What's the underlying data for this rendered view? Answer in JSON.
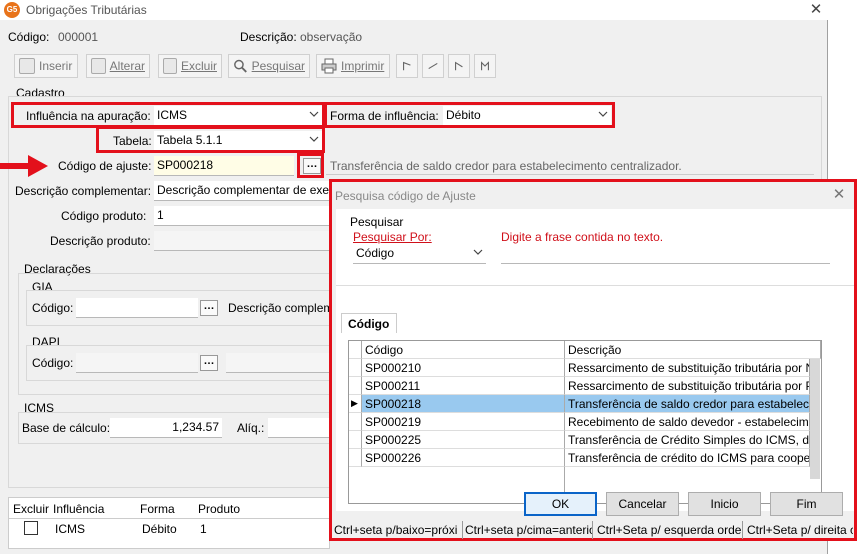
{
  "window": {
    "title": "Obrigações Tributárias",
    "app_icon_text": "G5"
  },
  "header": {
    "codigo_label": "Código:",
    "codigo_value": "000001",
    "descricao_label": "Descrição:",
    "descricao_value": "observação"
  },
  "toolbar": {
    "inserir": "Inserir",
    "alterar": "Alterar",
    "excluir": "Excluir",
    "pesquisar": "Pesquisar",
    "imprimir": "Imprimir"
  },
  "cadastro": {
    "section_label": "Cadastro",
    "influencia_label": "Influência na apuração:",
    "influencia_value": "ICMS",
    "forma_label": "Forma de influência:",
    "forma_value": "Débito",
    "tabela_label": "Tabela:",
    "tabela_value": "Tabela 5.1.1",
    "codigo_ajuste_label": "Código de ajuste:",
    "codigo_ajuste_value": "SP000218",
    "codigo_ajuste_desc": "Transferência de saldo credor  para estabelecimento centralizador.",
    "desc_complementar_label": "Descrição complementar:",
    "desc_complementar_value": "Descrição complementar de exer",
    "codigo_produto_label": "Código produto:",
    "codigo_produto_value": "1",
    "descricao_produto_label": "Descrição produto:",
    "declaracoes_label": "Declarações",
    "gia_label": "GIA",
    "gia_codigo_label": "Código:",
    "gia_descricao_label": "Descrição complem",
    "dapi_label": "DAPI",
    "dapi_codigo_label": "Código:",
    "icms_label": "ICMS",
    "base_calculo_label": "Base de cálculo:",
    "base_calculo_value": "1,234.57",
    "aliq_label": "Alíq.:"
  },
  "bottom_grid": {
    "columns": [
      "Excluir",
      "Influência",
      "Forma",
      "Produto"
    ],
    "row": {
      "influencia": "ICMS",
      "forma": "Débito",
      "produto": "1"
    }
  },
  "dialog": {
    "title": "Pesquisa código de Ajuste",
    "pesquisar_label": "Pesquisar",
    "pesquisar_por_label": "Pesquisar Por:",
    "pesquisar_por_value": "Código",
    "frase_label": "Digite a frase contida no texto.",
    "tab_label": "Código",
    "columns": [
      "Código",
      "Descrição"
    ],
    "rows": [
      {
        "codigo": "SP000210",
        "descricao": "Ressarcimento de substituição tributária por Nota Fisc"
      },
      {
        "codigo": "SP000211",
        "descricao": "Ressarcimento de substituição tributária por Pedido d"
      },
      {
        "codigo": "SP000218",
        "descricao": "Transferência de saldo credor  para estabelecimento"
      },
      {
        "codigo": "SP000219",
        "descricao": "Recebimento de saldo devedor - estabelecimento cen"
      },
      {
        "codigo": "SP000225",
        "descricao": "Transferência de Crédito Simples do ICMS, decorrent"
      },
      {
        "codigo": "SP000226",
        "descricao": "Transferência de crédito do ICMS para cooperativa c"
      }
    ],
    "selected_index": 2,
    "buttons": {
      "ok": "OK",
      "cancelar": "Cancelar",
      "inicio": "Inicio",
      "fim": "Fim"
    },
    "status": [
      "Ctrl+seta p/baixo=próxi",
      "Ctrl+seta p/cima=anterio",
      "Ctrl+Seta p/ esquerda orde",
      "Ctrl+Seta p/ direita c"
    ]
  },
  "colors": {
    "highlight_red": "#e3101b",
    "selection_blue": "#99c9ef",
    "field_yellow": "#fffde6"
  }
}
